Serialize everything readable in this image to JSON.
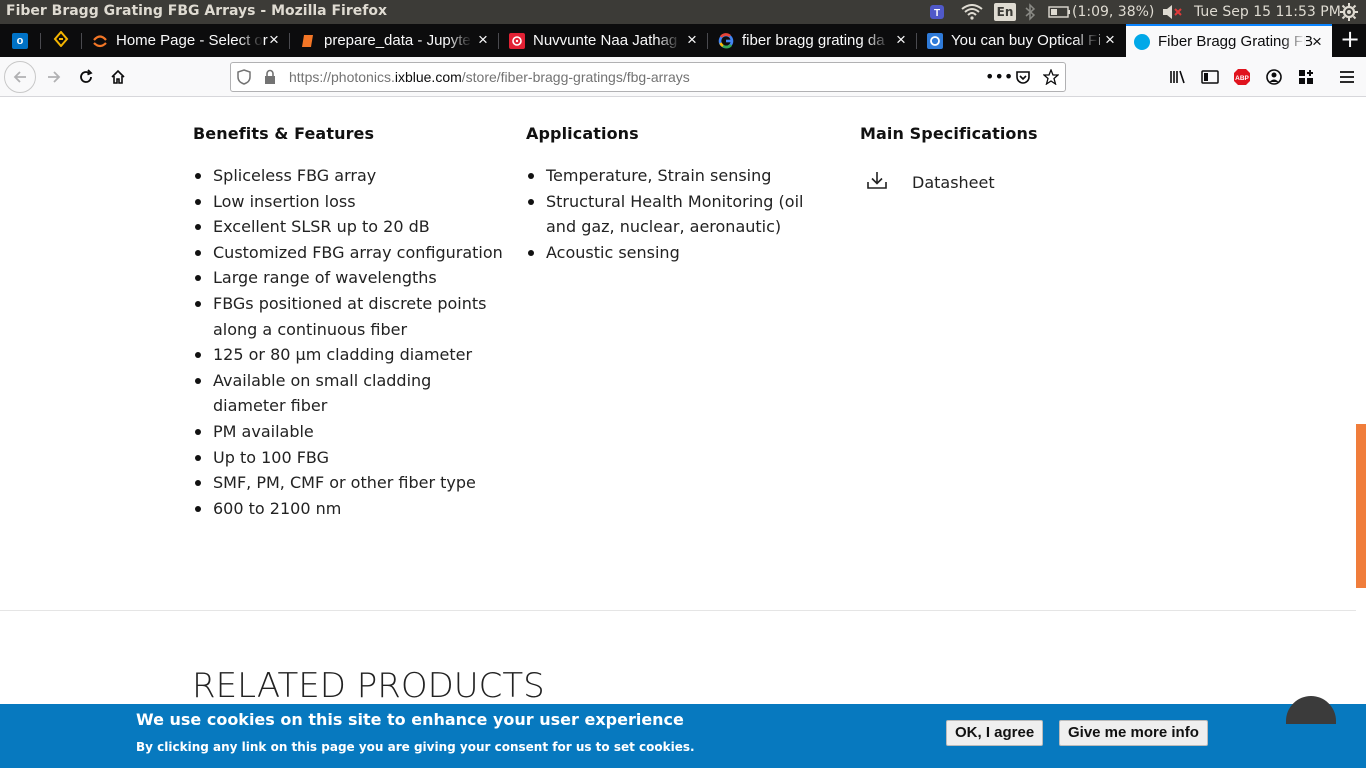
{
  "os": {
    "window_title": "Fiber Bragg Grating FBG Arrays - Mozilla Firefox",
    "language": "En",
    "battery": "(1:09, 38%)",
    "clock": "Tue Sep 15 11:53 PM"
  },
  "tabs": [
    {
      "label": "",
      "favicon": "outlook-icon",
      "color": "#0072c6"
    },
    {
      "label": "",
      "favicon": "pinned-app-icon",
      "color": "#f4b400"
    },
    {
      "label": "Home Page - Select or",
      "favicon": "jupyter-icon",
      "color": "#f37626"
    },
    {
      "label": "prepare_data - Jupyte",
      "favicon": "notebook-icon",
      "color": "#f37626"
    },
    {
      "label": "Nuvvunte Naa Jathag",
      "favicon": "music-icon",
      "color": "#e22134"
    },
    {
      "label": "fiber bragg grating da",
      "favicon": "google-icon",
      "color": "#4285f4"
    },
    {
      "label": "You can buy Optical Fi",
      "favicon": "site-icon",
      "color": "#2f7bd9"
    },
    {
      "label": "Fiber Bragg Grating FB",
      "favicon": "ixblue-icon",
      "color": "#00a8e8"
    }
  ],
  "nav": {
    "url_prefix": "https://photonics.",
    "url_host": "ixblue.com",
    "url_path": "/store/fiber-bragg-gratings/fbg-arrays"
  },
  "content": {
    "benefits_heading": "Benefits & Features",
    "benefits": [
      "Spliceless FBG array",
      "Low insertion loss",
      "Excellent SLSR up to 20 dB",
      "Customized FBG array configuration",
      "Large range of wavelengths",
      "FBGs positioned at discrete points along a continuous fiber",
      "125 or 80 µm cladding diameter",
      "Available on small cladding diameter fiber",
      "PM available",
      "Up to 100 FBG",
      "SMF, PM, CMF or other fiber type",
      "600 to 2100 nm"
    ],
    "applications_heading": "Applications",
    "applications": [
      "Temperature, Strain sensing",
      "Structural Health Monitoring (oil and gaz, nuclear, aeronautic)",
      "Acoustic sensing"
    ],
    "specs_heading": "Main Specifications",
    "datasheet_label": "Datasheet",
    "related_title": "RELATED PRODUCTS"
  },
  "cookie": {
    "title": "We use cookies on this site to enhance your user experience",
    "text": "By clicking any link on this page you are giving your consent for us to set cookies.",
    "ok_label": "OK, I agree",
    "more_label": "Give me more info",
    "background": "#0779bf"
  },
  "accent": "#f07d3b"
}
